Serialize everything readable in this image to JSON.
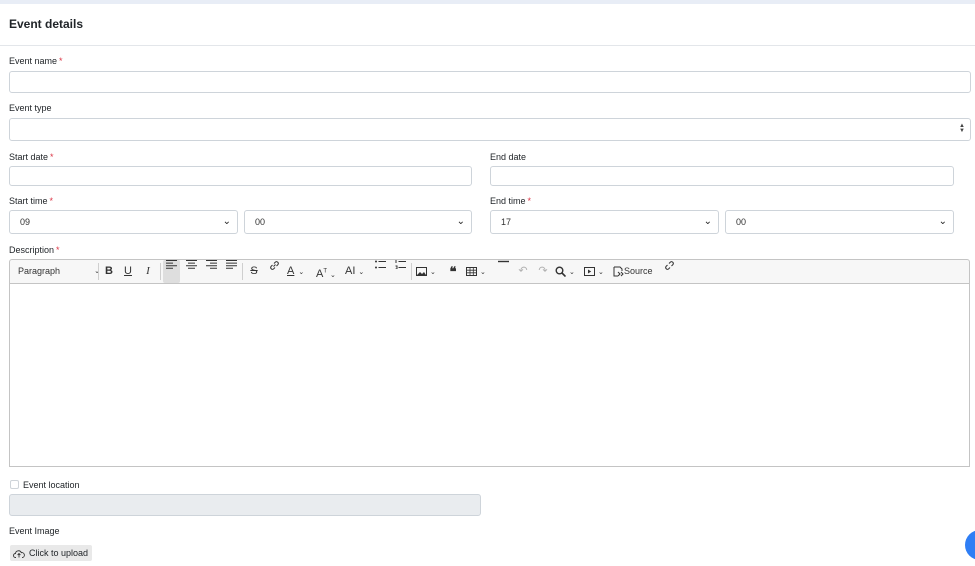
{
  "header": {
    "title": "Event details"
  },
  "required_mark": "*",
  "form": {
    "event_name": {
      "label": "Event name",
      "value": ""
    },
    "event_type": {
      "label": "Event type",
      "value": ""
    },
    "start_date": {
      "label": "Start date",
      "value": ""
    },
    "end_date": {
      "label": "End date",
      "value": ""
    },
    "start_time": {
      "label": "Start time",
      "hour": "09",
      "minute": "00"
    },
    "end_time": {
      "label": "End time",
      "hour": "17",
      "minute": "00"
    },
    "description": {
      "label": "Description"
    },
    "event_location": {
      "label": "Event location",
      "checked": false
    },
    "event_image": {
      "label": "Event Image",
      "upload_label": "Click to upload"
    }
  },
  "toolbar": {
    "heading_select": "Paragraph",
    "source_label": "Source",
    "buttons": [
      "bold-icon",
      "underline-icon",
      "italic-icon",
      "align-left-icon",
      "align-center-icon",
      "align-right-icon",
      "align-justify-icon",
      "strikethrough-icon",
      "link-icon",
      "font-color-icon",
      "font-size-icon",
      "text-format-icon",
      "bulleted-list-icon",
      "numbered-list-icon",
      "image-icon",
      "blockquote-icon",
      "table-icon",
      "horizontal-line-icon",
      "undo-icon",
      "redo-icon",
      "find-replace-icon",
      "media-embed-icon",
      "source-icon",
      "unlink-icon"
    ]
  },
  "colors": {
    "required": "#dc3545",
    "accent": "#2f7ef5",
    "border": "#ced4da"
  }
}
